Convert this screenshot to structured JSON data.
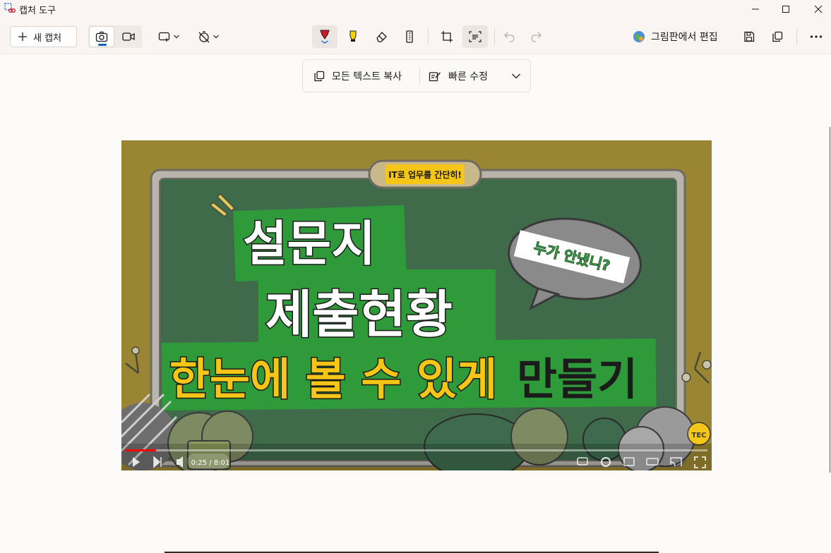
{
  "window": {
    "title": "캡처 도구"
  },
  "toolbar": {
    "new_capture_label": "새 캡처",
    "edit_in_paint_label": "그림판에서 편집"
  },
  "text_actions": {
    "copy_all_text_label": "모든 텍스트 복사",
    "quick_redact_label": "빠른 수정"
  },
  "capture": {
    "badge": "IT로 업무를 간단히!",
    "title_line1": "설문지",
    "title_line2": "제출현황",
    "subtitle_yellow": "한눈에 볼 수 있게",
    "subtitle_black": "만들기",
    "bubble": "누가 안냈니?",
    "video_time": "0:25 / 8:01",
    "video_progress": 0.052,
    "logo_text": "TEC"
  },
  "colors": {
    "accent": "#0b62c4",
    "pen_red": "#d0182a",
    "highlighter_yellow": "#f5d20a",
    "board_green": "#3f6b4b",
    "banner_green": "#2f9a3a",
    "frame_olive": "#9a8632"
  },
  "icons": [
    "app-icon",
    "minimize-icon",
    "maximize-icon",
    "close-icon",
    "plus-icon",
    "camera-icon",
    "video-icon",
    "rectangle-snip-icon",
    "chevron-down-icon",
    "timer-off-icon",
    "ballpoint-pen-icon",
    "highlighter-icon",
    "eraser-icon",
    "ruler-icon",
    "crop-icon",
    "text-actions-icon",
    "undo-icon",
    "redo-icon",
    "paint-icon",
    "save-icon",
    "copy-icon",
    "more-icon",
    "copy-text-icon",
    "redact-icon"
  ]
}
